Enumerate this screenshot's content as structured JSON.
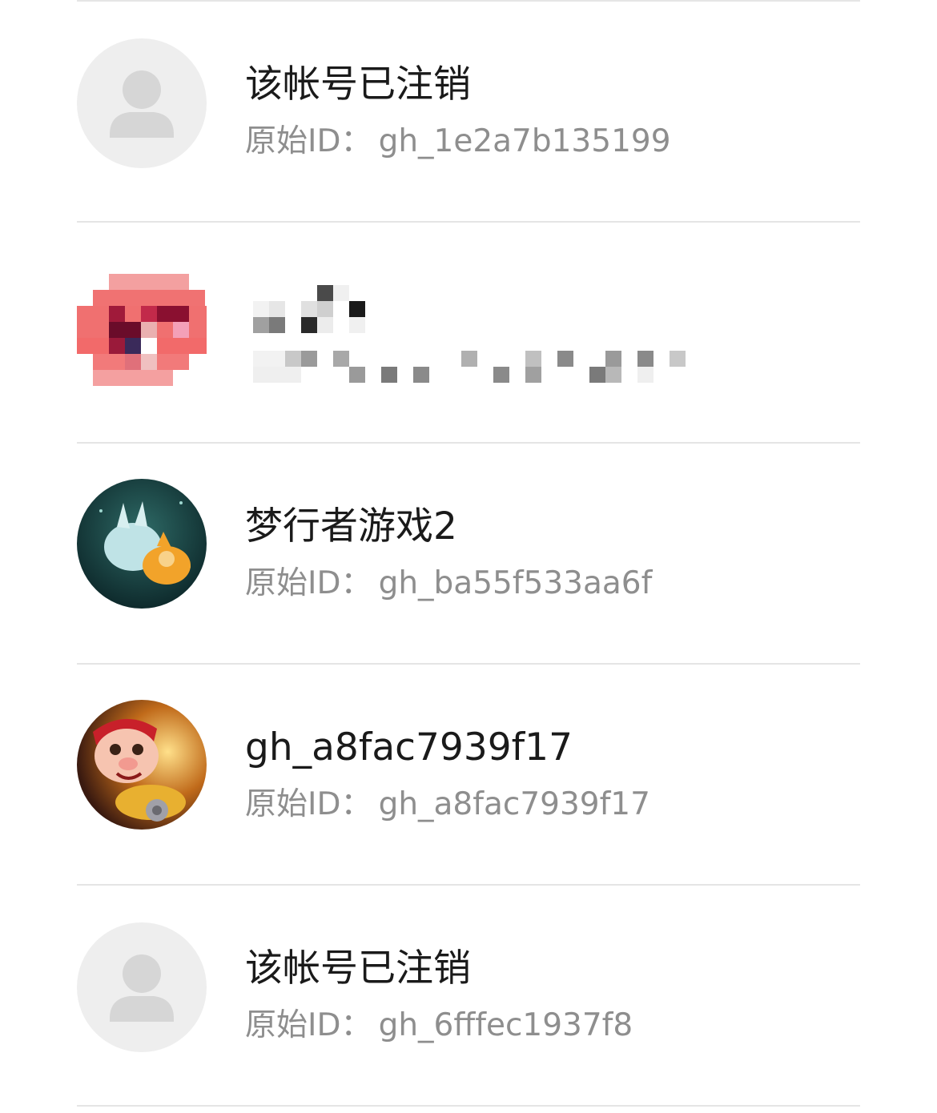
{
  "accounts": [
    {
      "name": "该帐号已注销",
      "id_label": "原始ID",
      "id_separator": "：",
      "original_id": "gh_1e2a7b135199",
      "avatar": "default-person-icon"
    },
    {
      "name": "",
      "id_label": "",
      "id_separator": "",
      "original_id": "",
      "avatar": "pixelated-avatar",
      "redacted": true
    },
    {
      "name": "梦行者游戏2",
      "id_label": "原始ID",
      "id_separator": "：",
      "original_id": "gh_ba55f533aa6f",
      "avatar": "game-character-avatar"
    },
    {
      "name": "gh_a8fac7939f17",
      "id_label": "原始ID",
      "id_separator": "：",
      "original_id": "gh_a8fac7939f17",
      "avatar": "cartoon-pig-avatar"
    },
    {
      "name": "该帐号已注销",
      "id_label": "原始ID",
      "id_separator": "：",
      "original_id": "gh_6fffec1937f8",
      "avatar": "default-person-icon"
    }
  ],
  "colors": {
    "name_text": "#1a1a1a",
    "id_text": "#8e8e8e",
    "divider": "#e5e5e5",
    "default_avatar_bg": "#eeeeee",
    "default_avatar_fg": "#d6d6d6"
  }
}
